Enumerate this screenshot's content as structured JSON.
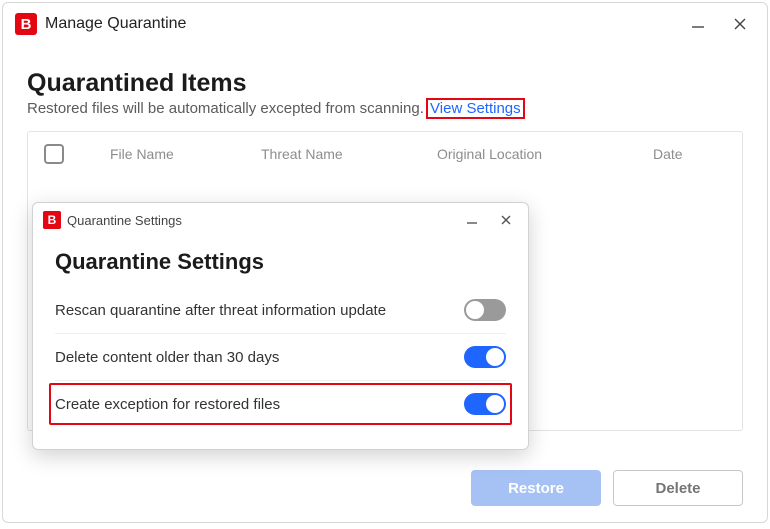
{
  "window": {
    "title": "Manage Quarantine"
  },
  "section": {
    "heading": "Quarantined Items",
    "subtitle": "Restored files will be automatically excepted from scanning.",
    "view_settings_link": "View Settings"
  },
  "table": {
    "columns": {
      "file_name": "File Name",
      "threat_name": "Threat Name",
      "original_location": "Original Location",
      "date": "Date"
    }
  },
  "footer": {
    "restore_label": "Restore",
    "delete_label": "Delete"
  },
  "modal": {
    "title": "Quarantine Settings",
    "heading": "Quarantine Settings",
    "settings": [
      {
        "label": "Rescan quarantine after threat information update",
        "enabled": false
      },
      {
        "label": "Delete content older than 30 days",
        "enabled": true
      },
      {
        "label": "Create exception for restored files",
        "enabled": true
      }
    ]
  }
}
